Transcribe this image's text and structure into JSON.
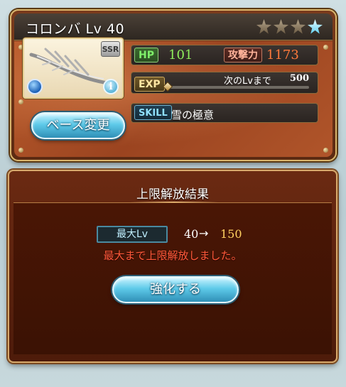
{
  "weapon": {
    "name": "コロンバ Lv 40",
    "rarity": "SSR",
    "stars": [
      {
        "active": false
      },
      {
        "active": false
      },
      {
        "active": false
      },
      {
        "active": true
      }
    ],
    "element_icon": "water-orb-icon",
    "info_icon": "info-icon",
    "info_glyph": "i"
  },
  "stats": {
    "hp_label": "HP",
    "hp_value": "101",
    "atk_label": "攻撃力",
    "atk_value": "1173",
    "exp_label": "EXP",
    "next_label": "次のLvまで",
    "next_value": "500",
    "exp_progress": 0.0,
    "skill_label": "SKILL",
    "skill_name": "雪の極意"
  },
  "buttons": {
    "change_base": "ベース変更",
    "enhance": "強化する"
  },
  "result": {
    "title": "上限解放結果",
    "max_lv_label": "最大Lv",
    "from": "40",
    "arrow": "→",
    "to": "150",
    "message": "最大まで上限解放しました。"
  },
  "colors": {
    "card_body": "#a84d24",
    "panel_bg": "#4d1b0a",
    "accent_gold": "#d9b46a",
    "accent_cyan": "#5ecae9",
    "lv_to": "#ffd060",
    "message": "#ff5a3a"
  }
}
